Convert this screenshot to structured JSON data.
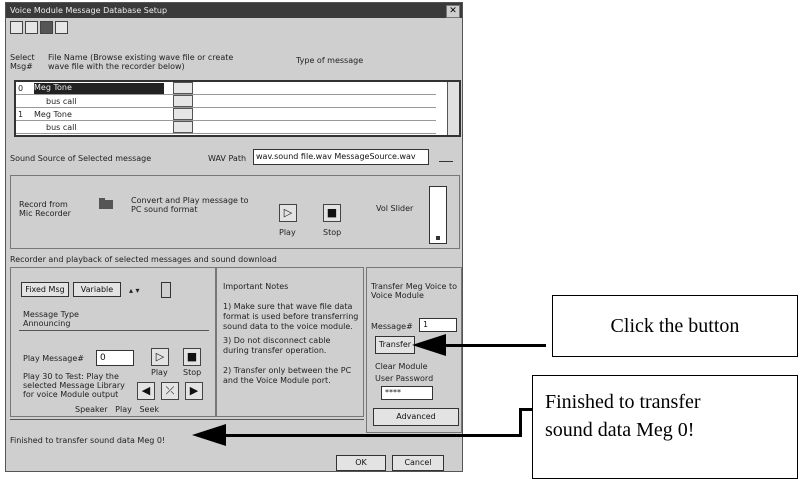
{
  "window": {
    "title": "Voice Module Message Database Setup",
    "close_glyph": "✕"
  },
  "toolbar": {
    "icons": [
      "new-icon",
      "open-icon",
      "save-icon",
      "print-icon"
    ]
  },
  "grid_header": {
    "select_label": "Select Msg#",
    "file_label": "File Name (Browse existing wave file or create wave file with the recorder below)",
    "type_label": "Type of message"
  },
  "grid_rows": [
    {
      "marker": "0",
      "name": "Meg Tone"
    },
    {
      "marker": "",
      "name": "bus call"
    },
    {
      "marker": "1",
      "name": "Meg Tone"
    },
    {
      "marker": "",
      "name": "bus call"
    }
  ],
  "path": {
    "left_label": "Sound Source of Selected message",
    "label": "WAV Path",
    "value": "wav.sound file.wav MessageSource.wav"
  },
  "recorder": {
    "record_label": "Record from Mic Recorder",
    "convert_label": "Convert and Play message to PC sound format",
    "sample_text": "Play",
    "stop_text": "Stop",
    "volume_label": "Vol Slider"
  },
  "section_caption": "Recorder and playback of selected messages and sound download",
  "playback": {
    "tab1": "Fixed Msg",
    "tab2": "Variable",
    "category_label": "Message Type",
    "category_value": "Announcing",
    "play_label": "Play Message#",
    "play_value": "0",
    "play_btn": "Play",
    "stop_btn": "Stop",
    "note": "Play 30 to Test: Play the selected Message Library for voice Module output",
    "footer": "Speaker   Play   Seek"
  },
  "tips": {
    "title": "Important Notes",
    "line1": "1) Make sure that wave file data",
    "line2": "format is used before transferring",
    "line3": "sound data to the voice module.",
    "line4": "2) Transfer only between the PC",
    "line5": "and the Voice Module port.",
    "line6": "3) Do not disconnect cable",
    "line7": "during transfer operation."
  },
  "transfer": {
    "title": "Transfer Meg Voice to Voice Module",
    "message_label": "Message#",
    "message_value": "1",
    "transfer_btn": "Transfer",
    "clear_label": "Clear Module",
    "password_label": "User Password",
    "password_value": "****",
    "bottom_btn": "Advanced"
  },
  "status": {
    "text": "Finished to transfer sound data Meg 0!"
  },
  "footer_buttons": {
    "ok": "OK",
    "cancel": "Cancel"
  },
  "annotations": {
    "callout_button": "Click the button",
    "callout_status_line1": "Finished to transfer",
    "callout_status_line2": "sound data Meg 0!"
  }
}
